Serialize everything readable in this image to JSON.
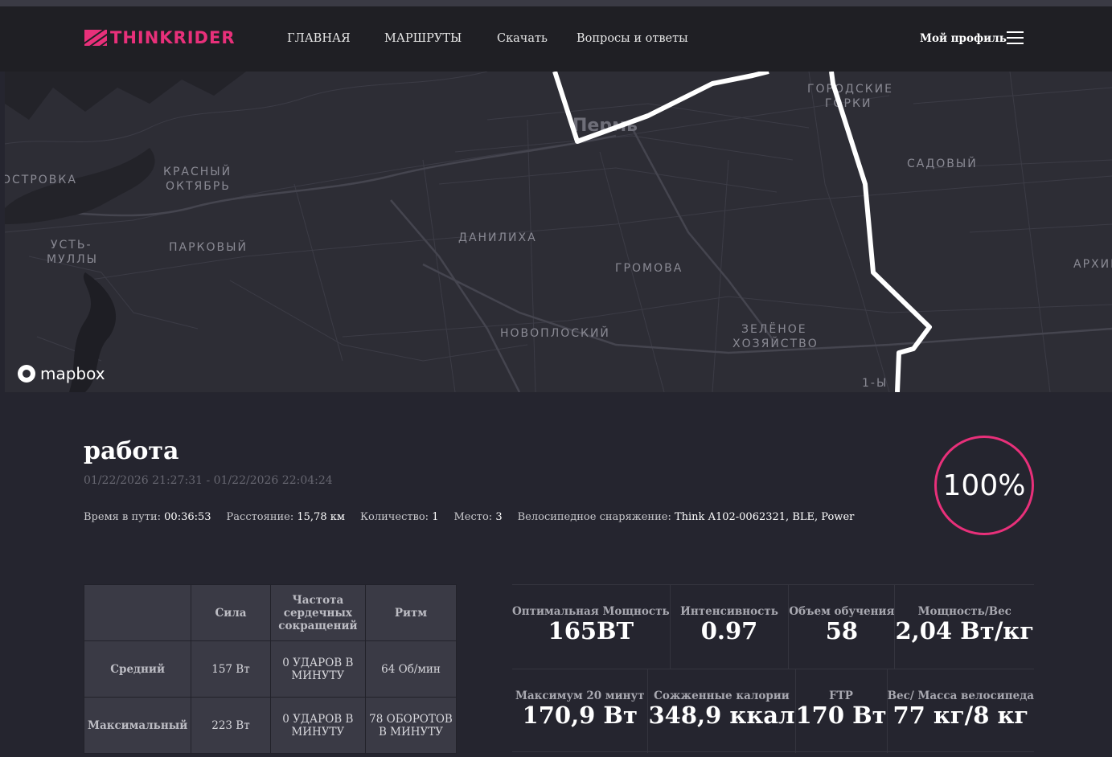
{
  "header": {
    "logo": "THINKRIDER",
    "nav": [
      "ГЛАВНАЯ",
      "МАРШРУТЫ",
      "Скачать",
      "Вопросы и ответы"
    ],
    "profile": "Мой профиль"
  },
  "map": {
    "attribution": "mapbox",
    "labels": [
      {
        "text": "ОСТРОВКА"
      },
      {
        "text": "КРАСНЫЙ ОКТЯБРЬ"
      },
      {
        "text": "УСТЬ-МУЛЛЫ"
      },
      {
        "text": "ПАРКОВЫЙ"
      },
      {
        "text": "ДАНИЛИХА"
      },
      {
        "text": "ГРОМОВА"
      },
      {
        "text": "НОВОПЛОСКИЙ"
      },
      {
        "text": "ЗЕЛЁНОЕ ХОЗЯЙСТВО"
      },
      {
        "text": "САДОВЫЙ"
      },
      {
        "text": "ГОРОДСКИЕ ГОРКИ"
      },
      {
        "text": "АРХИЕ"
      },
      {
        "text": "Пермь"
      },
      {
        "text": "1-Ы"
      }
    ]
  },
  "activity": {
    "title": "работа",
    "dates": "01/22/2026 21:27:31 - 01/22/2026 22:04:24",
    "meta": [
      {
        "label": "Время в пути:",
        "value": "00:36:53"
      },
      {
        "label": "Расстояние:",
        "value": "15,78 км"
      },
      {
        "label": "Количество:",
        "value": "1"
      },
      {
        "label": "Место:",
        "value": "3"
      },
      {
        "label": "Велосипедное снаряжение:",
        "value": "Think A102-0062321, BLE, Power"
      }
    ],
    "completion": "100%"
  },
  "chart_data": {
    "type": "table",
    "columns": [
      "",
      "Сила",
      "Частота сердечных сокращений",
      "Ритм"
    ],
    "rows": [
      [
        "Средний",
        "157 Вт",
        "0 УДАРОВ В МИНУТУ",
        "64 Об/мин"
      ],
      [
        "Максимальный",
        "223 Вт",
        "0 УДАРОВ В МИНУТУ",
        "78 ОБОРОТОВ В МИНУТУ"
      ]
    ]
  },
  "summary": [
    [
      {
        "label": "Оптимальная Мощность",
        "value": "165ВТ"
      },
      {
        "label": "Интенсивность",
        "value": "0.97"
      },
      {
        "label": "Объем обучения",
        "value": "58"
      },
      {
        "label": "Мощность/Вес",
        "value": "2,04 Вт/кг"
      }
    ],
    [
      {
        "label": "Максимум 20 минут",
        "value": "170,9 Вт"
      },
      {
        "label": "Сожженные калории",
        "value": "348,9 ккал"
      },
      {
        "label": "FTP",
        "value": "170 Вт"
      },
      {
        "label": "Вес/ Масса велосипеда",
        "value": "77 кг/8 кг"
      }
    ]
  ],
  "colors": {
    "accent": "#e8307a",
    "header": "#1f1f24",
    "page": "#25252f",
    "map": "#2d2d35"
  }
}
